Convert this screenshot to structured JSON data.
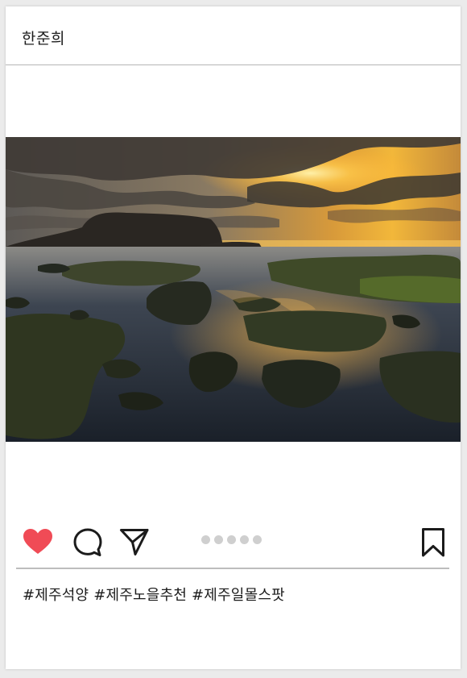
{
  "header": {
    "username": "한준희"
  },
  "post": {
    "image_alt": "",
    "carousel": {
      "total": 5,
      "active": 0
    }
  },
  "actions": {
    "liked": true,
    "like_color": "#f04b56",
    "icons": [
      "heart-icon",
      "comment-icon",
      "send-icon",
      "bookmark-icon"
    ]
  },
  "caption": {
    "hashtags": "#제주석양 #제주노을추천 #제주일몰스팟"
  }
}
